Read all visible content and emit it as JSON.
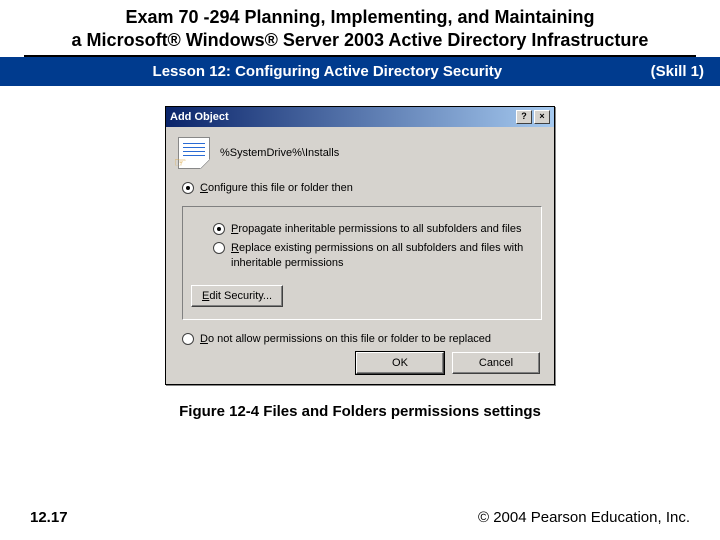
{
  "header": {
    "line1": "Exam 70 -294 Planning, Implementing, and Maintaining",
    "line2": "a Microsoft® Windows® Server 2003 Active Directory Infrastructure"
  },
  "lesson_bar": {
    "lesson": "Lesson 12: Configuring Active Directory Security",
    "skill": "(Skill 1)"
  },
  "dialog": {
    "title": "Add Object",
    "help_glyph": "?",
    "close_glyph": "×",
    "path": "%SystemDrive%\\Installs",
    "options": {
      "configure": "Configure this file or folder then",
      "propagate": "Propagate inheritable permissions to all subfolders and files",
      "replace": "Replace existing permissions on all subfolders and files with inheritable permissions",
      "donot": "Do not allow permissions on this file or folder to be replaced"
    },
    "buttons": {
      "edit": "Edit Security...",
      "ok": "OK",
      "cancel": "Cancel"
    }
  },
  "figure_caption": "Figure 12-4 Files and Folders permissions settings",
  "footer": {
    "page": "12.17",
    "copyright": "© 2004 Pearson Education, Inc."
  }
}
